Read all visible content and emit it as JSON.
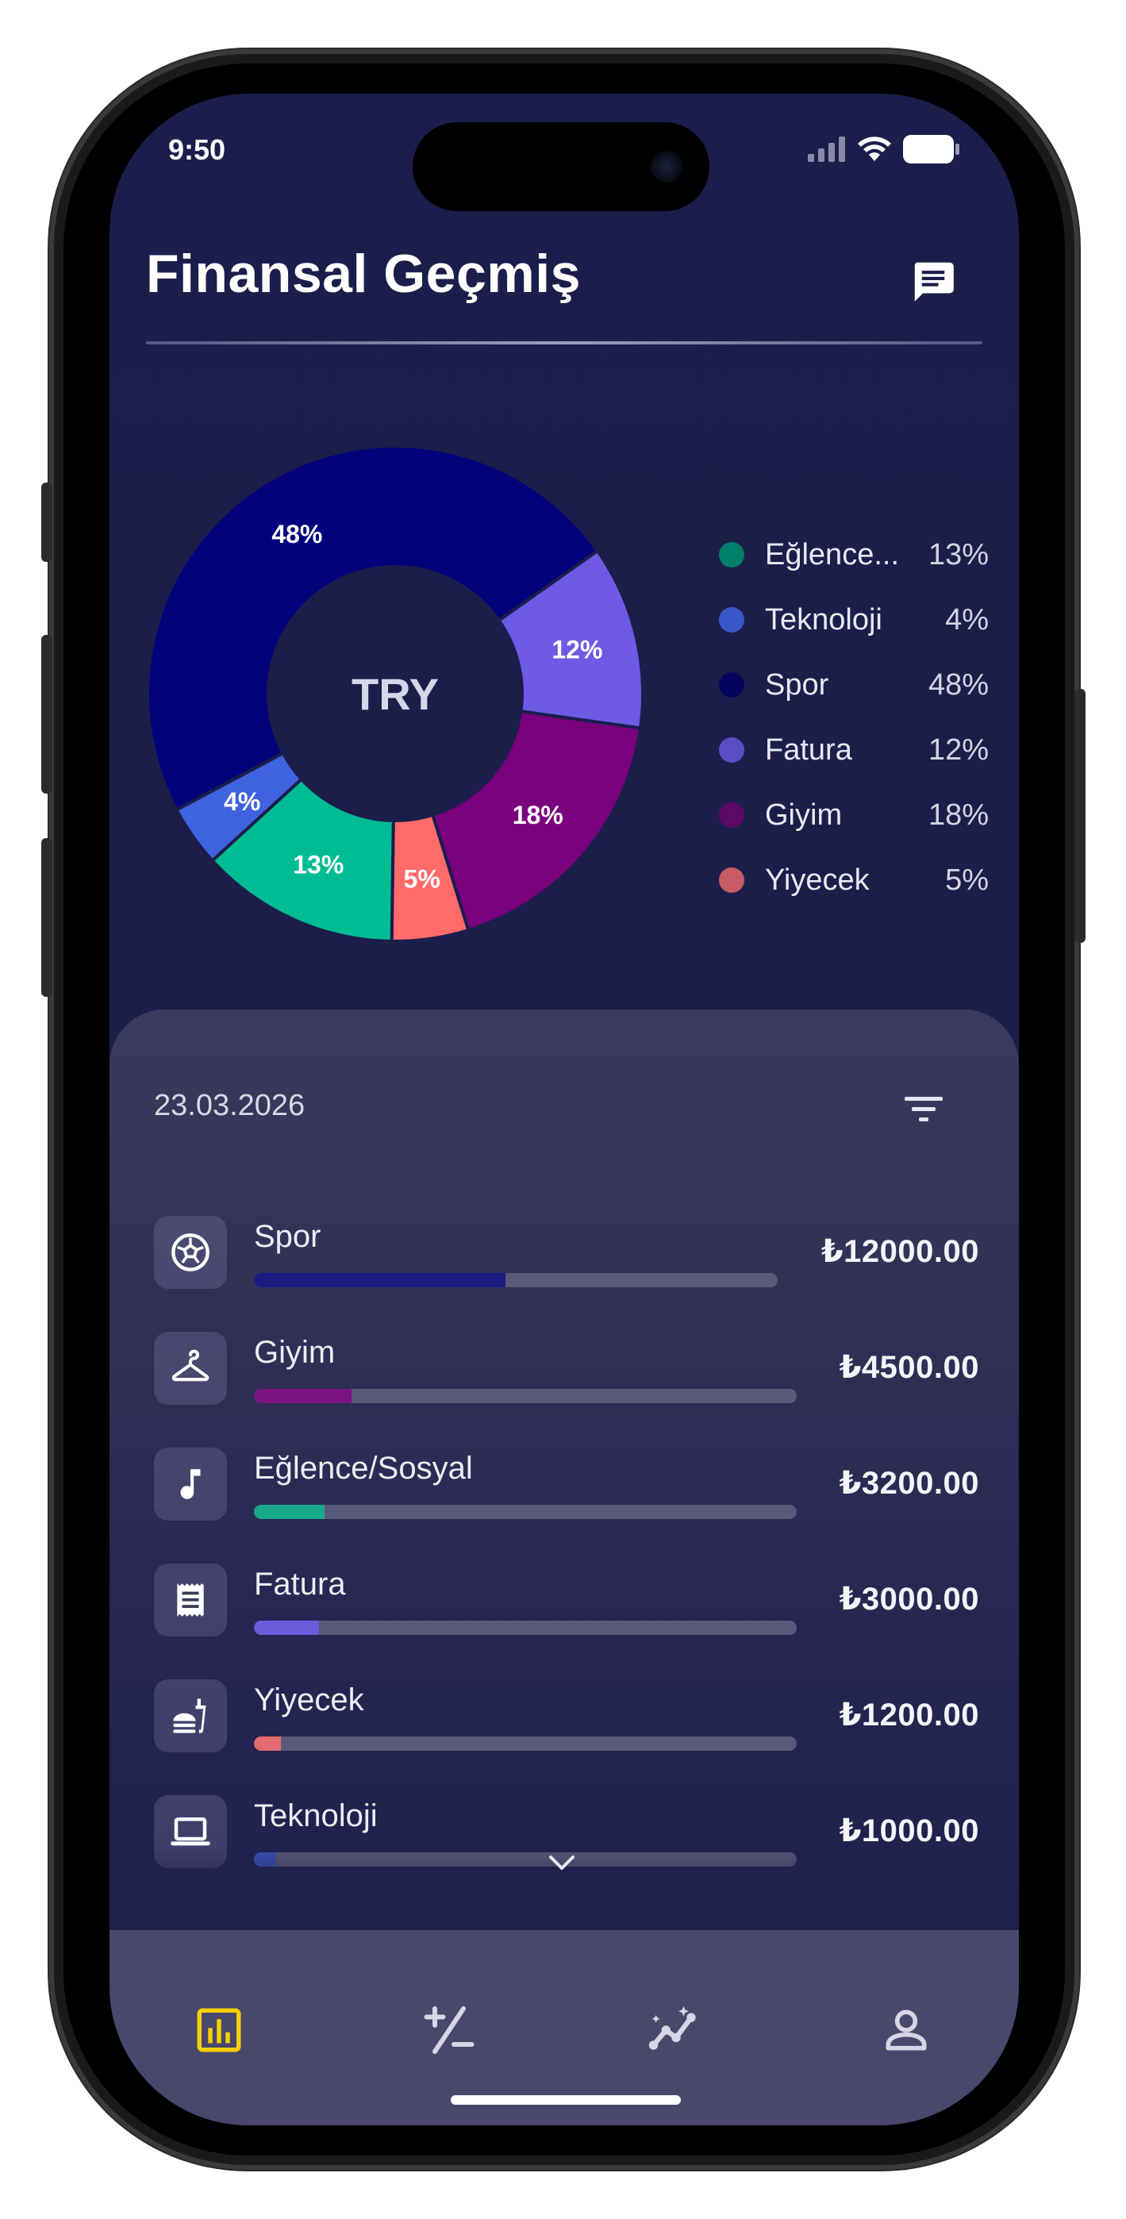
{
  "status_bar": {
    "time": "9:50"
  },
  "header": {
    "title": "Finansal Geçmiş"
  },
  "chart_data": {
    "type": "pie",
    "donut": true,
    "center_label": "TRY",
    "legend_position": "right",
    "start_angle_deg": -11,
    "slices": [
      {
        "name": "Spor",
        "legend_name": "Spor",
        "value": 48,
        "color": "#02027d"
      },
      {
        "name": "Fatura",
        "legend_name": "Fatura",
        "value": 12,
        "color": "#6e5ae4"
      },
      {
        "name": "Giyim",
        "legend_name": "Giyim",
        "value": 18,
        "color": "#7b007d"
      },
      {
        "name": "Yiyecek",
        "legend_name": "Yiyecek",
        "value": 5,
        "color": "#ff6b6b"
      },
      {
        "name": "Eğlence/Sosyal",
        "legend_name": "Eğlence...",
        "value": 13,
        "color": "#00bc94"
      },
      {
        "name": "Teknoloji",
        "legend_name": "Teknoloji",
        "value": 4,
        "color": "#3f63e0"
      }
    ],
    "slice_labels": [
      "48%",
      "12%",
      "18%",
      "5%",
      "13%",
      "4%"
    ]
  },
  "legend": [
    {
      "name": "Eğlence...",
      "pct": "13%",
      "color": "#00806a"
    },
    {
      "name": "Teknoloji",
      "pct": "4%",
      "color": "#3a56c8"
    },
    {
      "name": "Spor",
      "pct": "48%",
      "color": "#050560"
    },
    {
      "name": "Fatura",
      "pct": "12%",
      "color": "#5b4cc4"
    },
    {
      "name": "Giyim",
      "pct": "18%",
      "color": "#5a0a64"
    },
    {
      "name": "Yiyecek",
      "pct": "5%",
      "color": "#c85c64"
    }
  ],
  "sheet": {
    "date": "23.03.2026",
    "items": [
      {
        "name": "Spor",
        "amount": "₺12000.00",
        "icon": "sports-soccer-icon",
        "color": "#1b1a80",
        "fill": 0.48
      },
      {
        "name": "Giyim",
        "amount": "₺4500.00",
        "icon": "hanger-icon",
        "color": "#7a1480",
        "fill": 0.18
      },
      {
        "name": "Eğlence/Sosyal",
        "amount": "₺3200.00",
        "icon": "music-note-icon",
        "color": "#18a88a",
        "fill": 0.13
      },
      {
        "name": "Fatura",
        "amount": "₺3000.00",
        "icon": "receipt-icon",
        "color": "#6c5cdc",
        "fill": 0.12
      },
      {
        "name": "Yiyecek",
        "amount": "₺1200.00",
        "icon": "fastfood-icon",
        "color": "#e46a70",
        "fill": 0.05
      },
      {
        "name": "Teknoloji",
        "amount": "₺1000.00",
        "icon": "laptop-icon",
        "color": "#3852b8",
        "fill": 0.04
      }
    ]
  },
  "nav": {
    "active_color": "#f5d000",
    "inactive_color": "#d8d6e6",
    "items": [
      "bar-chart-icon",
      "plus-minus-icon",
      "insights-icon",
      "person-icon"
    ]
  }
}
